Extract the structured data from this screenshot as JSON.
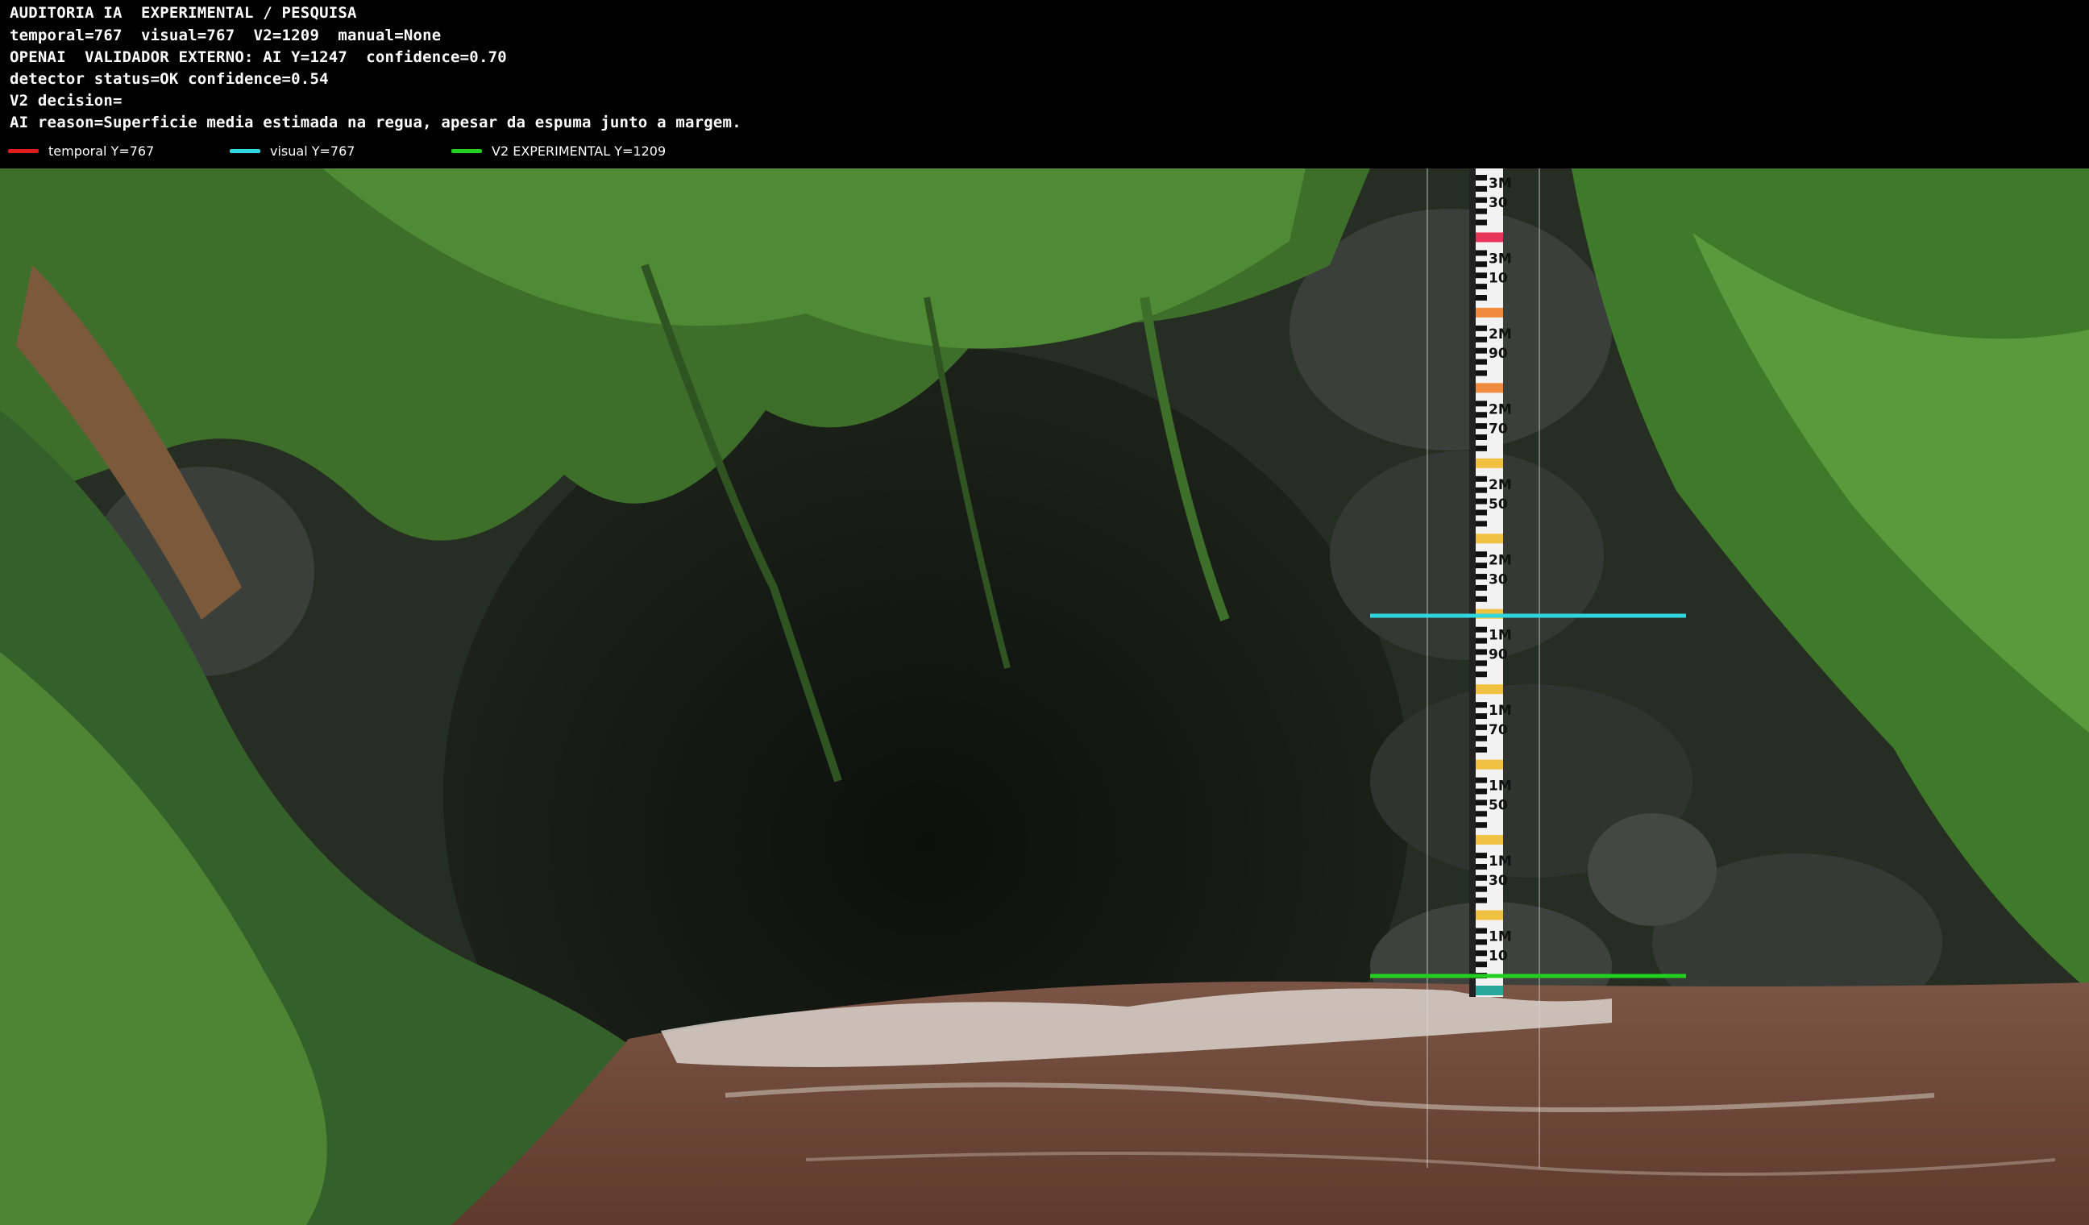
{
  "hud": {
    "line1": "AUDITORIA IA  EXPERIMENTAL / PESQUISA",
    "line2": "temporal=767  visual=767  V2=1209  manual=None",
    "line3": "OPENAI  VALIDADOR EXTERNO: AI Y=1247  confidence=0.70",
    "line4": "detector status=OK confidence=0.54",
    "line5": "V2 decision=",
    "line6": "AI reason=Superficie media estimada na regua, apesar da espuma junto a margem."
  },
  "legend": [
    {
      "label": "temporal Y=767",
      "color": "#e01b1b"
    },
    {
      "label": "visual Y=767",
      "color": "#2fd6e0"
    },
    {
      "label": "V2 EXPERIMENTAL Y=1209",
      "color": "#22d11f"
    }
  ],
  "overlays": {
    "visual_line_color": "#2fd6e0",
    "v2_line_color": "#22d11f"
  },
  "gauge": {
    "labels": [
      "3M",
      "3M",
      "2M",
      "2M",
      "2M",
      "2M",
      "1M",
      "1M",
      "1M",
      "1M",
      "1M"
    ],
    "sublabels": [
      "30",
      "10",
      "90",
      "70",
      "50",
      "30",
      "90",
      "70",
      "50",
      "30",
      "10"
    ]
  },
  "colors": {
    "water": "#6e4636",
    "foliage": "#3f7a2a",
    "rock": "#3a3d3a"
  }
}
